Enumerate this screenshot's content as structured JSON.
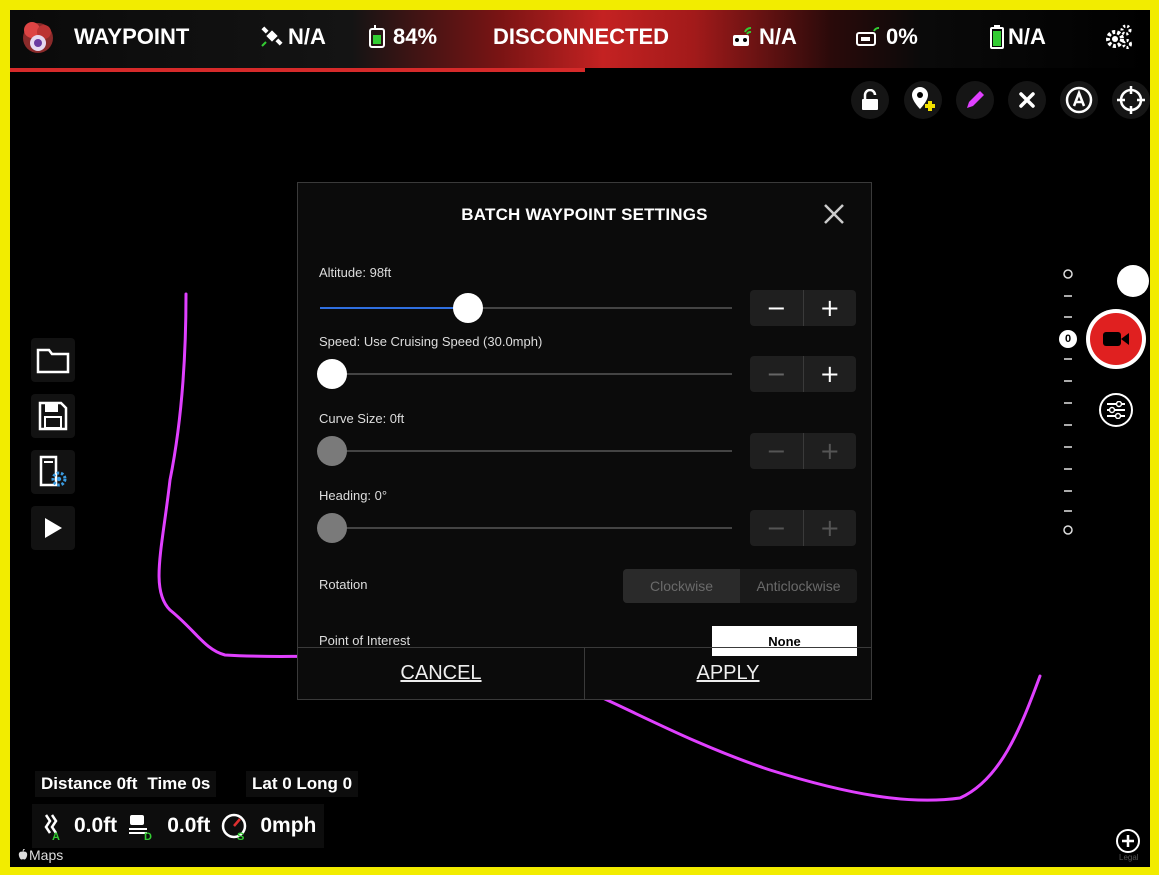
{
  "topbar": {
    "app_name": "WAYPOINT",
    "gps": "N/A",
    "remote_battery": "84%",
    "status": "DISCONNECTED",
    "rc_signal": "N/A",
    "video_signal": "0%",
    "aircraft_battery": "N/A"
  },
  "dialog": {
    "title": "BATCH WAYPOINT SETTINGS",
    "altitude_label": "Altitude: 98ft",
    "altitude_fraction": 0.34,
    "speed_label": "Speed: Use Cruising Speed (30.0mph)",
    "speed_fraction": 0.0,
    "curve_label": "Curve Size: 0ft",
    "curve_fraction": 0.0,
    "heading_label": "Heading: 0°",
    "heading_fraction": 0.0,
    "minus": "−",
    "plus": "+",
    "rotation_label": "Rotation",
    "rotation_options": [
      "Clockwise",
      "Anticlockwise"
    ],
    "poi_label": "Point of Interest",
    "poi_value": "None",
    "cancel": "CANCEL",
    "apply": "APPLY"
  },
  "camera": {
    "zoom_label": "0"
  },
  "stats": {
    "distance": "Distance 0ft",
    "time": "Time 0s",
    "latlong": "Lat 0 Long 0",
    "altitude": "0.0ft",
    "distance_home": "0.0ft",
    "speed": "0mph"
  },
  "map": {
    "attribution": "Maps",
    "legal": "Legal"
  },
  "colors": {
    "route": "#e040ff",
    "accent_blue": "#2f6fe0",
    "record_red": "#e02020",
    "border_yellow": "#f2ec00"
  },
  "icons": {
    "lock": "lock-icon",
    "add_waypoint": "add-waypoint-icon",
    "edit": "pencil-icon",
    "clear": "close-icon",
    "auto": "auto-icon",
    "locate": "crosshair-icon",
    "folder": "folder-icon",
    "save": "save-icon",
    "settings_file": "file-settings-icon",
    "play": "play-icon",
    "record": "video-record-icon",
    "camera_settings": "sliders-icon",
    "zoom_in": "plus-circle-icon"
  }
}
